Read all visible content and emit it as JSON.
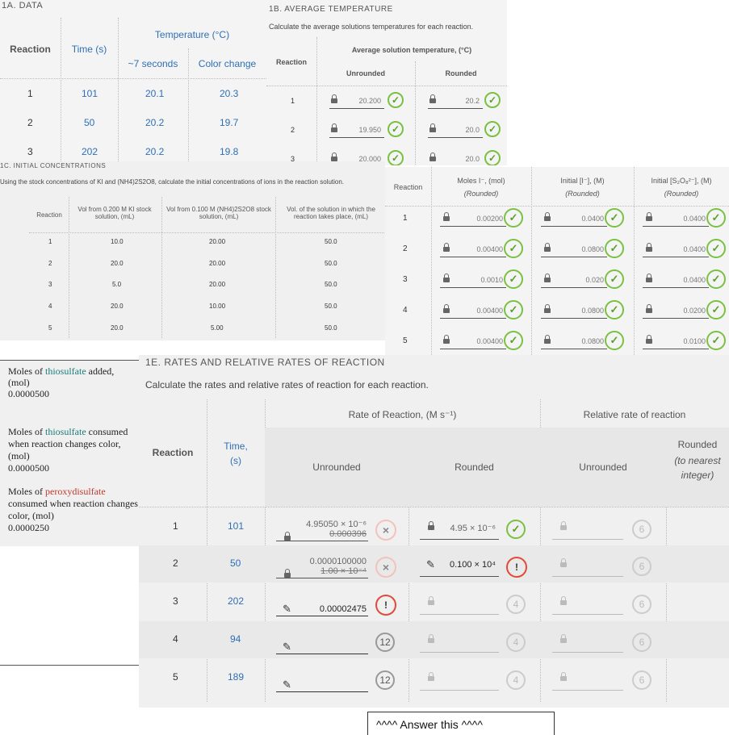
{
  "s1a": {
    "title": "1A. DATA",
    "h_reaction": "Reaction",
    "h_time": "Time (s)",
    "h_temp": "Temperature (°C)",
    "h_seven": "~7 seconds",
    "h_color": "Color change",
    "rows": [
      {
        "r": "1",
        "t": "101",
        "a": "20.1",
        "b": "20.3"
      },
      {
        "r": "2",
        "t": "50",
        "a": "20.2",
        "b": "19.7"
      },
      {
        "r": "3",
        "t": "202",
        "a": "20.2",
        "b": "19.8"
      }
    ]
  },
  "s1b": {
    "title": "1B. AVERAGE TEMPERATURE",
    "instruction": "Calculate the average solutions temperatures for each reaction.",
    "h_reaction": "Reaction",
    "h_avg": "Average solution temperature, (°C)",
    "h_unr": "Unrounded",
    "h_rnd": "Rounded",
    "rows": [
      {
        "r": "1",
        "u": "20.200",
        "v": "20.2"
      },
      {
        "r": "2",
        "u": "19.950",
        "v": "20.0"
      },
      {
        "r": "3",
        "u": "20.000",
        "v": "20.0"
      }
    ]
  },
  "s1c": {
    "title": "1C. INITIAL CONCENTRATIONS",
    "instruction": "Using the stock concentrations of KI and (NH4)2S2O8, calculate the initial concentrations of ions in the reaction solution.",
    "h_reaction": "Reaction",
    "h_ki": "Vol from 0.200 M KI stock solution, (mL)",
    "h_nh": "Vol from 0.100 M (NH4)2S2O8 stock solution, (mL)",
    "h_vol": "Vol. of the solution in which the reaction takes place, (mL)",
    "rows": [
      {
        "r": "1",
        "a": "10.0",
        "b": "20.00",
        "c": "50.0"
      },
      {
        "r": "2",
        "a": "20.0",
        "b": "20.00",
        "c": "50.0"
      },
      {
        "r": "3",
        "a": "5.0",
        "b": "20.00",
        "c": "50.0"
      },
      {
        "r": "4",
        "a": "20.0",
        "b": "10.00",
        "c": "50.0"
      },
      {
        "r": "5",
        "a": "20.0",
        "b": "5.00",
        "c": "50.0"
      }
    ]
  },
  "s1d": {
    "h_reaction": "Reaction",
    "h_moles": "Moles I⁻, (mol)",
    "h_moles_sub": "(Rounded)",
    "h_initi": "Initial [I⁻], (M)",
    "h_initi_sub": "(Rounded)",
    "h_inits": "Initial [S₂O₈²⁻], (M)",
    "h_inits_sub": "(Rounded)",
    "rows": [
      {
        "r": "1",
        "m": "0.00200",
        "i": "0.0400",
        "s": "0.0400"
      },
      {
        "r": "2",
        "m": "0.00400",
        "i": "0.0800",
        "s": "0.0400"
      },
      {
        "r": "3",
        "m": "0.0010",
        "i": "0.020",
        "s": "0.0400"
      },
      {
        "r": "4",
        "m": "0.00400",
        "i": "0.0800",
        "s": "0.0200"
      },
      {
        "r": "5",
        "m": "0.00400",
        "i": "0.0800",
        "s": "0.0100"
      }
    ]
  },
  "notes": {
    "n1_pre": "Moles of ",
    "n1_hl": "thiosulfate",
    "n1_post": " added, (mol)",
    "n1_val": "0.0000500",
    "n2_pre": "Moles of ",
    "n2_hl": "thiosulfate",
    "n2_post": " consumed when reaction changes color, (mol)",
    "n2_val": "0.0000500",
    "n3_pre": "Moles of ",
    "n3_hl": "peroxydisulfate",
    "n3_post": " consumed when reaction changes color, (mol)",
    "n3_val": "0.0000250"
  },
  "s1e": {
    "title": "1E. RATES AND RELATIVE RATES OF REACTION",
    "instruction": "Calculate the rates and relative rates of reaction for each reaction.",
    "h_reaction": "Reaction",
    "h_time": "Time, (s)",
    "h_rate": "Rate of Reaction, (M s⁻¹)",
    "h_rel": "Relative rate of reaction",
    "h_unr": "Unrounded",
    "h_rnd": "Rounded",
    "h_unr2": "Unrounded",
    "h_rnd2": "Rounded",
    "h_rnd2_sub": "(to nearest integer)",
    "rows": [
      {
        "r": "1",
        "t": "101",
        "uval": "4.95050 × 10⁻⁶",
        "uold": "0.000396",
        "ubadge": "×",
        "rval": "4.95 × 10⁻⁶",
        "rbadge": "✓",
        "relu": "6"
      },
      {
        "r": "2",
        "t": "50",
        "uval": "0.0000100000",
        "uold": "1.00 × 10⁻⁴",
        "ubadge": "×",
        "rval": "0.100 × 10⁴",
        "rbadge": "!",
        "relu": "6"
      },
      {
        "r": "3",
        "t": "202",
        "uval": "0.00002475",
        "uold": "",
        "ubadge": "!",
        "rval": "",
        "rbadge": "4",
        "relu": "6"
      },
      {
        "r": "4",
        "t": "94",
        "uval": "",
        "uold": "",
        "ubadge": "12",
        "rval": "",
        "rbadge": "4",
        "relu": "6"
      },
      {
        "r": "5",
        "t": "189",
        "uval": "",
        "uold": "",
        "ubadge": "12",
        "rval": "",
        "rbadge": "4",
        "relu": "6"
      }
    ]
  },
  "answer": "^^^^ Answer this ^^^^"
}
